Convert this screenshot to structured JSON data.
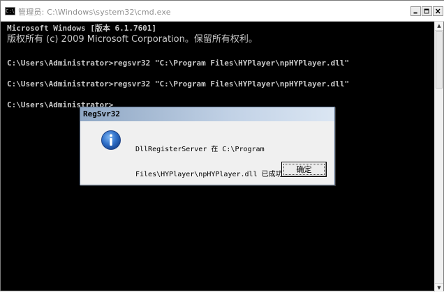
{
  "window": {
    "title": "管理员: C:\\Windows\\system32\\cmd.exe",
    "icon": "console-icon",
    "controls": [
      "minimize-icon",
      "maximize-icon",
      "close-icon"
    ]
  },
  "console": {
    "lines": [
      "Microsoft Windows [版本 6.1.7601]",
      "版权所有 (c) 2009 Microsoft Corporation。保留所有权利。",
      "",
      "C:\\Users\\Administrator>regsvr32 \"C:\\Program Files\\HYPlayer\\npHYPlayer.dll\"",
      "",
      "C:\\Users\\Administrator>regsvr32 \"C:\\Program Files\\HYPlayer\\npHYPlayer.dll\"",
      "",
      "C:\\Users\\Administrator>"
    ]
  },
  "dialog": {
    "title": "RegSvr32",
    "icon": "info-icon",
    "message_line1": "DllRegisterServer 在 C:\\Program",
    "message_line2": "Files\\HYPlayer\\npHYPlayer.dll 已成功。",
    "ok_label": "确定"
  },
  "colors": {
    "console_bg": "#000000",
    "console_text": "#c8c8c8",
    "dialog_bg": "#f0f0f0"
  }
}
